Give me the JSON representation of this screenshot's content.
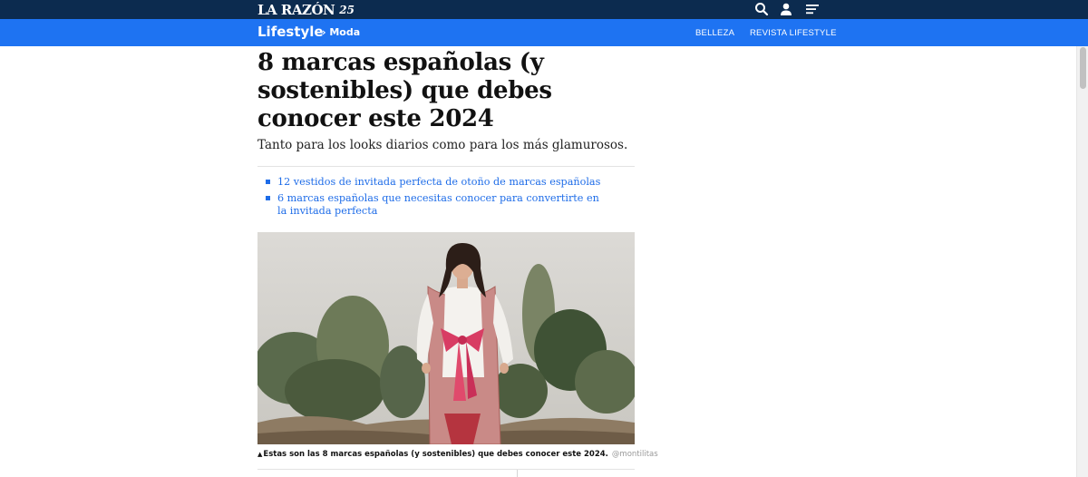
{
  "header": {
    "logo_text": "LA RAZÓN",
    "logo_anniversary": "25",
    "icons": [
      "search-icon",
      "user-icon",
      "menu-icon"
    ]
  },
  "navbar": {
    "section": "Lifestyle",
    "breadcrumb": "› Moda",
    "links": [
      "BELLEZA",
      "REVISTA LIFESTYLE"
    ]
  },
  "article": {
    "headline": "8 marcas españolas (y sostenibles) que debes conocer este 2024",
    "subheadline": "Tanto para los looks diarios como para los más glamurosos.",
    "related": [
      "12 vestidos de invitada perfecta de otoño de marcas españolas",
      "6 marcas españolas que necesitas conocer para convertirte en la invitada perfecta"
    ],
    "caption": "Estas son las 8 marcas españolas (y sostenibles) que debes conocer este 2024.",
    "credit": "@montilitas"
  },
  "colors": {
    "topbar": "#0c2b4f",
    "navbar": "#1e73f2",
    "link": "#1e6ce8"
  }
}
